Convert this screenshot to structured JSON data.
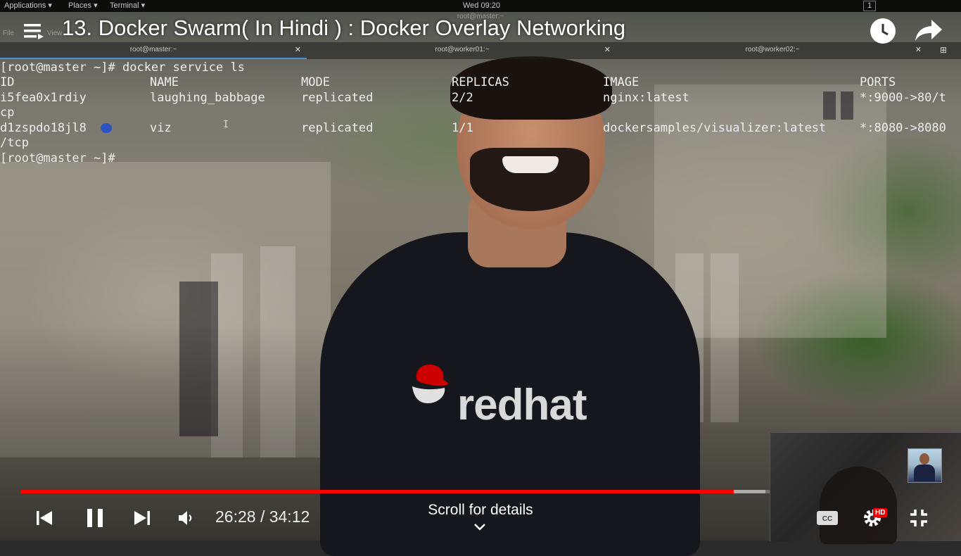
{
  "desktop_bar": {
    "applications": "Applications ▾",
    "places": "Places ▾",
    "terminal": "Terminal ▾",
    "clock": "Wed 09:20",
    "workspace": "1"
  },
  "terminal": {
    "window_title": "root@master:~",
    "menu": [
      "File",
      "View"
    ],
    "tabs": [
      {
        "label": "root@master:~"
      },
      {
        "label": "root@worker01:~"
      },
      {
        "label": "root@worker02:~"
      }
    ],
    "command_line": "[root@master ~]# docker service ls",
    "headers": {
      "id": "ID",
      "name": "NAME",
      "mode": "MODE",
      "replicas": "REPLICAS",
      "image": "IMAGE",
      "ports": "PORTS"
    },
    "rows": [
      {
        "id": "i5fea0x1rdiy",
        "name": "laughing_babbage",
        "mode": "replicated",
        "replicas": "2/2",
        "image": "nginx:latest",
        "ports": "*:9000->80/t",
        "wrap": "cp"
      },
      {
        "id": "d1zspdo18jl8",
        "name": "viz",
        "mode": "replicated",
        "replicas": "1/1",
        "image": "dockersamples/visualizer:latest",
        "ports": "*:8080->8080",
        "wrap": "/tcp"
      }
    ],
    "prompt": "[root@master ~]#"
  },
  "video": {
    "title": "13. Docker Swarm( In Hindi ) : Docker Overlay Networking",
    "shirt_logo": "redhat"
  },
  "player": {
    "current_time": "26:28",
    "duration": "34:12",
    "time_display": "26:28 / 34:12",
    "scroll_hint": "Scroll for details",
    "hd_badge": "HD",
    "progress_played_fraction": 0.775,
    "progress_buffered_fraction": 0.809,
    "accent_color": "#ff0000"
  },
  "icons": {
    "menu": "menu-icon",
    "watch_later": "clock-icon",
    "share": "share-icon",
    "previous": "previous-icon",
    "pause": "pause-icon",
    "next": "next-icon",
    "volume": "volume-icon",
    "captions": "captions-icon",
    "settings": "gear-icon",
    "exit_fullscreen": "exit-fullscreen-icon"
  }
}
